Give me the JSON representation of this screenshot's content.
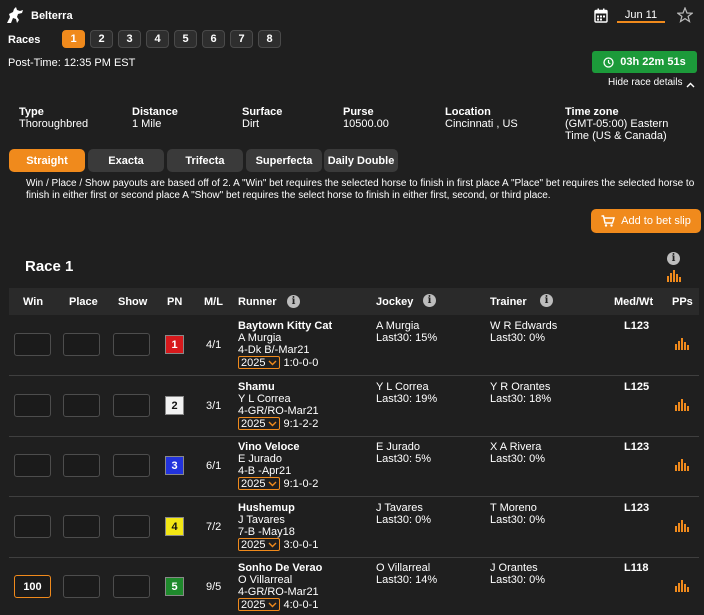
{
  "header": {
    "track": "Belterra",
    "races_label": "Races",
    "races": [
      "1",
      "2",
      "3",
      "4",
      "5",
      "6",
      "7",
      "8"
    ],
    "active_race": "1",
    "post_time": "Post-Time: 12:35 PM EST",
    "date": "Jun 11",
    "countdown": "03h 22m 51s",
    "hide_details": "Hide race details"
  },
  "details": [
    {
      "label": "Type",
      "value": "Thoroughbred"
    },
    {
      "label": "Distance",
      "value": "1 Mile"
    },
    {
      "label": "Surface",
      "value": "Dirt"
    },
    {
      "label": "Purse",
      "value": "10500.00"
    },
    {
      "label": "Location",
      "value": "Cincinnati , US"
    },
    {
      "label": "Time zone",
      "value": "(GMT-05:00) Eastern Time (US & Canada)"
    }
  ],
  "bet_types": [
    "Straight",
    "Exacta",
    "Trifecta",
    "Superfecta",
    "Daily Double"
  ],
  "active_bet_type": "Straight",
  "description": "Win / Place / Show payouts are based off of 2. A \"Win\" bet requires the selected horse to finish in first place A \"Place\" bet requires the selected horse to finish in either first or second place A \"Show\" bet requires the select horse to finish in either first, second, or third place.",
  "add_to_slip": "Add to bet slip",
  "race_title": "Race 1",
  "columns": [
    "Win",
    "Place",
    "Show",
    "PN",
    "M/L",
    "Runner",
    "Jockey",
    "Trainer",
    "Med/Wt",
    "PPs"
  ],
  "runners": [
    {
      "win": "",
      "place": "",
      "show": "",
      "pn": "1",
      "pn_bg": "#d7191c",
      "pn_fg": "#ffffff",
      "ml": "4/1",
      "name": "Baytown Kitty Cat",
      "rider": "A Murgia",
      "info": "4-Dk B/-Mar21",
      "year": "2025",
      "record": "1:0-0-0",
      "jockey": "A Murgia",
      "jockey_stat": "Last30: 15%",
      "trainer": "W R Edwards",
      "trainer_stat": "Last30: 0%",
      "medwt": "L123"
    },
    {
      "win": "",
      "place": "",
      "show": "",
      "pn": "2",
      "pn_bg": "#f2f2f2",
      "pn_fg": "#111111",
      "ml": "3/1",
      "name": "Shamu",
      "rider": "Y L Correa",
      "info": "4-GR/RO-Mar21",
      "year": "2025",
      "record": "9:1-2-2",
      "jockey": "Y L Correa",
      "jockey_stat": "Last30: 19%",
      "trainer": "Y R Orantes",
      "trainer_stat": "Last30: 18%",
      "medwt": "L125"
    },
    {
      "win": "",
      "place": "",
      "show": "",
      "pn": "3",
      "pn_bg": "#2233dd",
      "pn_fg": "#ffffff",
      "ml": "6/1",
      "name": "Vino Veloce",
      "rider": "E Jurado",
      "info": "4-B -Apr21",
      "year": "2025",
      "record": "9:1-0-2",
      "jockey": "E Jurado",
      "jockey_stat": "Last30: 5%",
      "trainer": "X A Rivera",
      "trainer_stat": "Last30: 0%",
      "medwt": "L123"
    },
    {
      "win": "",
      "place": "",
      "show": "",
      "pn": "4",
      "pn_bg": "#f2e614",
      "pn_fg": "#111111",
      "ml": "7/2",
      "name": "Hushemup",
      "rider": "J Tavares",
      "info": "7-B -May18",
      "year": "2025",
      "record": "3:0-0-1",
      "jockey": "J Tavares",
      "jockey_stat": "Last30: 0%",
      "trainer": "T Moreno",
      "trainer_stat": "Last30: 0%",
      "medwt": "L123"
    },
    {
      "win": "100",
      "place": "",
      "show": "",
      "pn": "5",
      "pn_bg": "#1f8a2c",
      "pn_fg": "#ffffff",
      "ml": "9/5",
      "name": "Sonho De Verao",
      "rider": "O Villarreal",
      "info": "4-GR/RO-Mar21",
      "year": "2025",
      "record": "4:0-0-1",
      "jockey": "O Villarreal",
      "jockey_stat": "Last30: 14%",
      "trainer": "J Orantes",
      "trainer_stat": "Last30: 0%",
      "medwt": "L118"
    }
  ],
  "colors": {
    "accent": "#f08a1c",
    "timer": "#1c9a3a",
    "background": "#1f1f1f"
  }
}
